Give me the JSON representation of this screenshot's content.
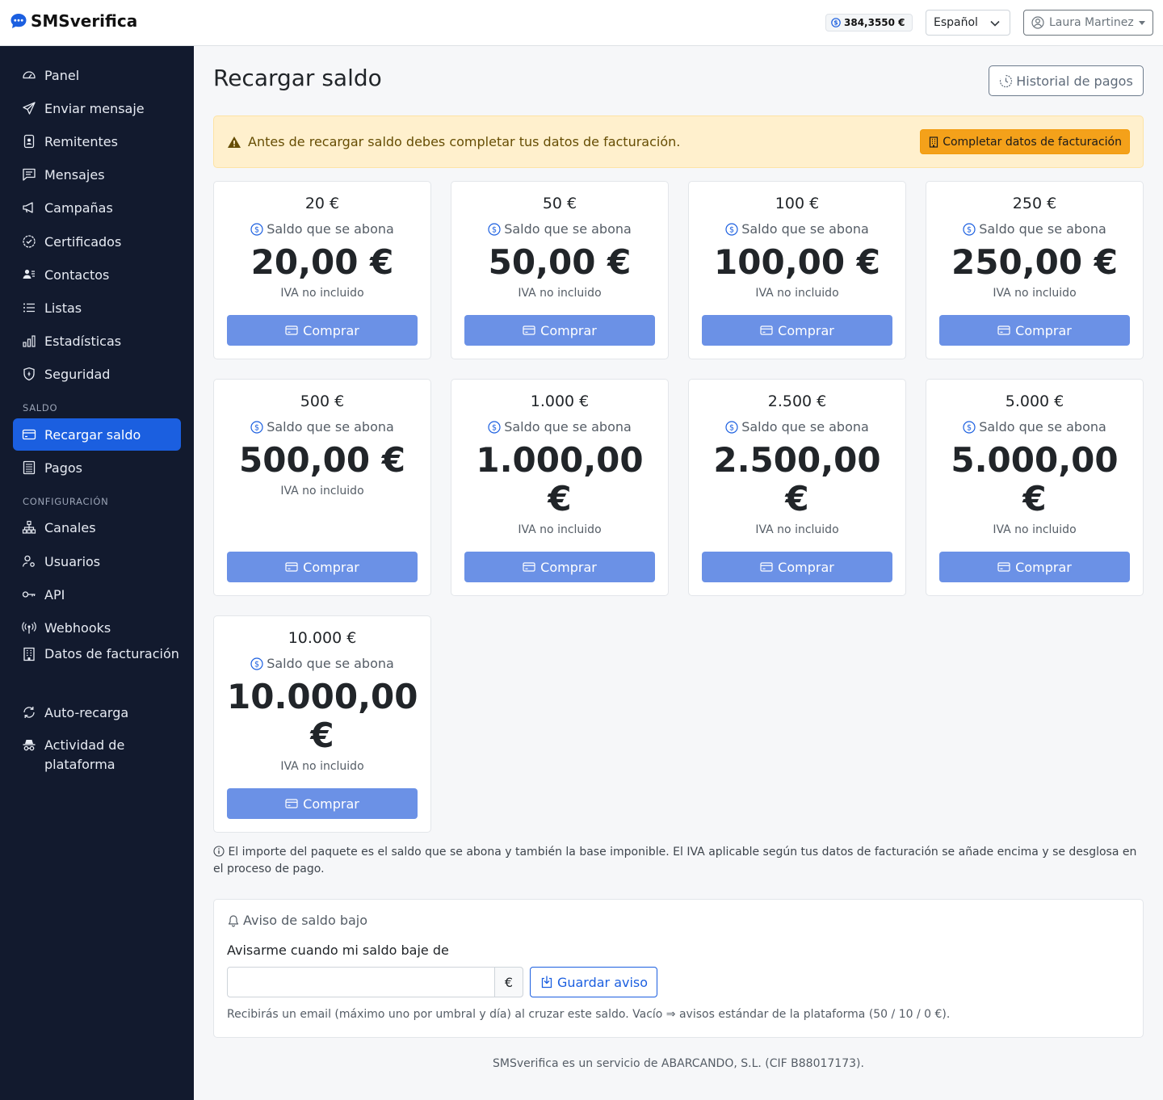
{
  "app": {
    "brand": "SMSverifica"
  },
  "header": {
    "balance": "384,3550 €",
    "language": "Español",
    "user": "Laura Martinez"
  },
  "sidebar": {
    "items": [
      {
        "label": "Panel",
        "icon": "speedometer-icon"
      },
      {
        "label": "Enviar mensaje",
        "icon": "send-icon"
      },
      {
        "label": "Remitentes",
        "icon": "person-badge-icon"
      },
      {
        "label": "Mensajes",
        "icon": "chat-icon"
      },
      {
        "label": "Campañas",
        "icon": "megaphone-icon"
      },
      {
        "label": "Certificados",
        "icon": "patch-check-icon"
      },
      {
        "label": "Contactos",
        "icon": "people-icon"
      },
      {
        "label": "Listas",
        "icon": "list-icon"
      },
      {
        "label": "Estadísticas",
        "icon": "bar-chart-icon"
      },
      {
        "label": "Seguridad",
        "icon": "shield-icon"
      }
    ],
    "saldo_section": "SALDO",
    "saldo_items": [
      {
        "label": "Recargar saldo",
        "icon": "credit-card-icon",
        "active": true
      },
      {
        "label": "Pagos",
        "icon": "receipt-icon"
      }
    ],
    "config_section": "CONFIGURACIÓN",
    "config_items": [
      {
        "label": "Canales",
        "icon": "diagram-icon"
      },
      {
        "label": "Usuarios",
        "icon": "person-gear-icon"
      },
      {
        "label": "API",
        "icon": "key-icon"
      },
      {
        "label": "Webhooks",
        "icon": "broadcast-icon"
      },
      {
        "label": "Datos de facturación",
        "icon": "building-icon"
      },
      {
        "label": "Auto-recarga",
        "icon": "arrow-repeat-icon"
      },
      {
        "label": "Actividad de plataforma",
        "icon": "incognito-icon"
      }
    ]
  },
  "main": {
    "title": "Recargar saldo",
    "history_button": "Historial de pagos",
    "alert": {
      "text": "Antes de recargar saldo debes completar tus datos de facturación.",
      "button": "Completar datos de facturación"
    },
    "subtitle": "Saldo que se abona",
    "iva": "IVA no incluido",
    "buy": "Comprar",
    "packages": [
      {
        "title": "20 €",
        "amount": "20,00 €"
      },
      {
        "title": "50 €",
        "amount": "50,00 €"
      },
      {
        "title": "100 €",
        "amount": "100,00 €"
      },
      {
        "title": "250 €",
        "amount": "250,00 €"
      },
      {
        "title": "500 €",
        "amount": "500,00 €"
      },
      {
        "title": "1.000 €",
        "amount": "1.000,00 €"
      },
      {
        "title": "2.500 €",
        "amount": "2.500,00 €"
      },
      {
        "title": "5.000 €",
        "amount": "5.000,00 €"
      },
      {
        "title": "10.000 €",
        "amount": "10.000,00 €"
      }
    ],
    "info_note": "El importe del paquete es el saldo que se abona y también la base imponible. El IVA aplicable según tus datos de facturación se añade encima y se desglosa en el proceso de pago.",
    "low_balance": {
      "header": "Aviso de saldo bajo",
      "label": "Avisarme cuando mi saldo baje de",
      "value": "",
      "currency": "€",
      "button": "Guardar aviso",
      "help": "Recibirás un email (máximo uno por umbral y día) al cruzar este saldo. Vacío ⇒ avisos estándar de la plataforma (50 / 10 / 0 €)."
    }
  },
  "footer": {
    "text": "SMSverifica es un servicio de ABARCANDO, S.L. (CIF B88017173)."
  },
  "colors": {
    "accent": "#1b5fe0",
    "sidebar": "#121a2e",
    "buy_button": "#6b91e6",
    "alert_bg": "#fff0cd",
    "alert_button": "#f4a11a"
  }
}
